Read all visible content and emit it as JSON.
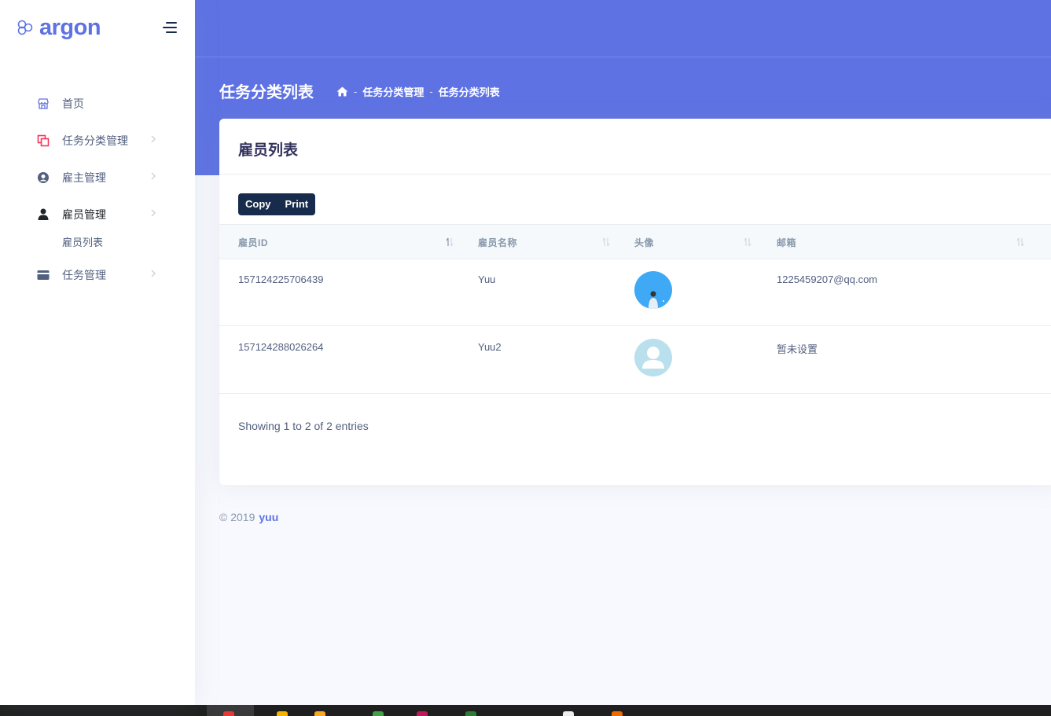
{
  "brand": {
    "name": "argon"
  },
  "sidebar": {
    "items": [
      {
        "label": "首页",
        "icon": "shop-icon",
        "color": "#5e72e4"
      },
      {
        "label": "任务分类管理",
        "icon": "copy-icon",
        "color": "#f5365c"
      },
      {
        "label": "雇主管理",
        "icon": "user-circle-icon",
        "color": "#525f7f"
      },
      {
        "label": "雇员管理",
        "icon": "user-icon",
        "color": "#212529"
      },
      {
        "label": "任务管理",
        "icon": "credit-card-icon",
        "color": "#525f7f"
      }
    ],
    "subitem": {
      "label": "雇员列表"
    }
  },
  "header": {
    "title": "任务分类列表",
    "breadcrumb": [
      "任务分类管理",
      "任务分类列表"
    ],
    "separator": "-"
  },
  "card": {
    "title": "雇员列表",
    "buttons": {
      "copy": "Copy",
      "print": "Print"
    },
    "columns": [
      "雇员ID",
      "雇员名称",
      "头像",
      "邮箱"
    ],
    "rows": [
      {
        "id": "157124225706439",
        "name": "Yuu",
        "email": "1225459207@qq.com",
        "avatar": "photo-avatar"
      },
      {
        "id": "157124288026264",
        "name": "Yuu2",
        "email": "暂未设置",
        "avatar": "default-avatar"
      }
    ],
    "info": "Showing 1 to 2 of 2 entries"
  },
  "footer": {
    "copyright": "© 2019",
    "author": "yuu"
  },
  "colors": {
    "primary": "#5e72e4",
    "dark": "#172b4d",
    "background": "#f8f9fe"
  }
}
